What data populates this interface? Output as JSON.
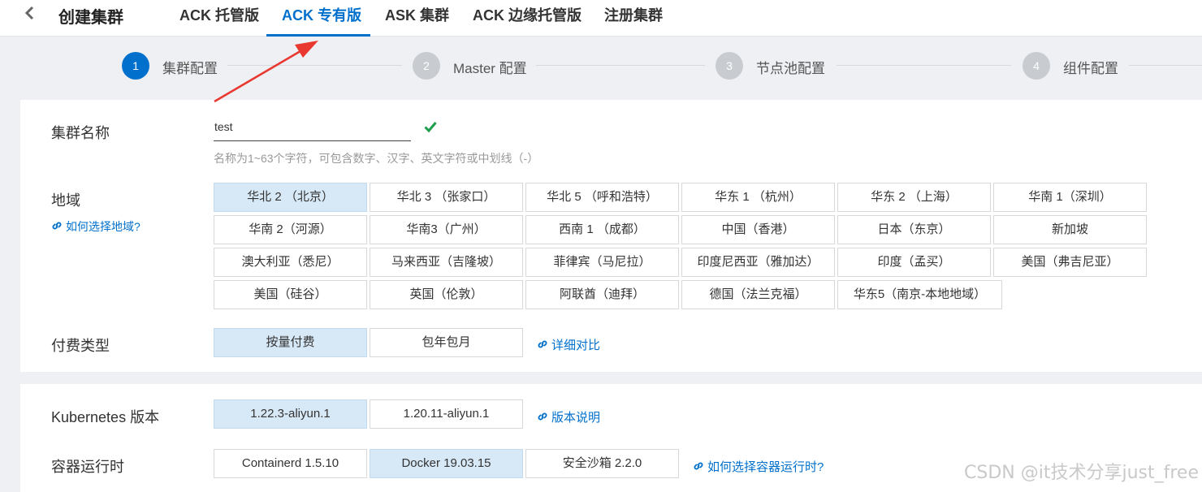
{
  "header": {
    "title": "创建集群",
    "tabs": [
      "ACK 托管版",
      "ACK 专有版",
      "ASK 集群",
      "ACK 边缘托管版",
      "注册集群"
    ],
    "active_tab": "ACK 专有版"
  },
  "steps": [
    {
      "num": "1",
      "label": "集群配置",
      "active": true
    },
    {
      "num": "2",
      "label": "Master 配置",
      "active": false
    },
    {
      "num": "3",
      "label": "节点池配置",
      "active": false
    },
    {
      "num": "4",
      "label": "组件配置",
      "active": false
    }
  ],
  "cluster_name": {
    "label": "集群名称",
    "value": "test",
    "hint": "名称为1~63个字符，可包含数字、汉字、英文字符或中划线（-）"
  },
  "region": {
    "label": "地域",
    "help_link": "如何选择地域?",
    "options": [
      "华北 2 （北京）",
      "华北 3 （张家口）",
      "华北 5 （呼和浩特）",
      "华东 1 （杭州）",
      "华东 2 （上海）",
      "华南 1（深圳）",
      "华南 2（河源）",
      "华南3（广州）",
      "西南 1 （成都）",
      "中国（香港）",
      "日本（东京）",
      "新加坡",
      "澳大利亚（悉尼）",
      "马来西亚（吉隆坡）",
      "菲律宾（马尼拉）",
      "印度尼西亚（雅加达）",
      "印度（孟买）",
      "美国（弗吉尼亚）",
      "美国（硅谷）",
      "英国（伦敦）",
      "阿联酋（迪拜）",
      "德国（法兰克福）",
      "华东5（南京-本地地域）"
    ],
    "selected": "华北 2 （北京）"
  },
  "billing": {
    "label": "付费类型",
    "options": [
      "按量付费",
      "包年包月"
    ],
    "selected": "按量付费",
    "link": "详细对比"
  },
  "k8s_version": {
    "label": "Kubernetes 版本",
    "options": [
      "1.22.3-aliyun.1",
      "1.20.11-aliyun.1"
    ],
    "selected": "1.22.3-aliyun.1",
    "link": "版本说明"
  },
  "runtime": {
    "label": "容器运行时",
    "options": [
      "Containerd 1.5.10",
      "Docker 19.03.15",
      "安全沙箱 2.2.0"
    ],
    "selected": "Docker 19.03.15",
    "link": "如何选择容器运行时?"
  },
  "watermark": "CSDN @it技术分享just_free",
  "colors": {
    "accent": "#0070cc",
    "selected_bg": "#d7e8f6",
    "annotation": "#e8382f",
    "success": "#1e9e4a"
  }
}
